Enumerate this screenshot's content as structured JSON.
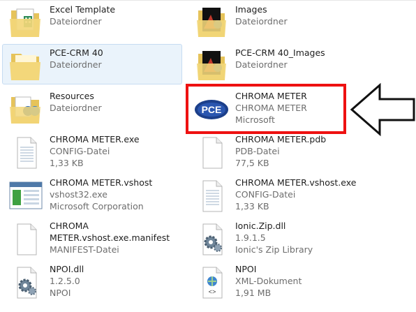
{
  "items": [
    {
      "name": "Excel Template",
      "line2": "Dateiordner",
      "line3": "",
      "icon": "folder-excel-icon"
    },
    {
      "name": "Images",
      "line2": "Dateiordner",
      "line3": "",
      "icon": "folder-images-icon"
    },
    {
      "name": "PCE-CRM 40",
      "line2": "Dateiordner",
      "line3": "",
      "icon": "folder-icon"
    },
    {
      "name": "PCE-CRM 40_Images",
      "line2": "Dateiordner",
      "line3": "",
      "icon": "folder-images-icon"
    },
    {
      "name": "Resources",
      "line2": "Dateiordner",
      "line3": "",
      "icon": "folder-resources-icon"
    },
    {
      "name": "CHROMA METER",
      "line2": "CHROMA METER",
      "line3": "Microsoft",
      "icon": "pce-app-icon"
    },
    {
      "name": "CHROMA METER.exe",
      "line2": "CONFIG-Datei",
      "line3": "1,33 KB",
      "icon": "document-icon"
    },
    {
      "name": "CHROMA METER.pdb",
      "line2": "PDB-Datei",
      "line3": "77,5 KB",
      "icon": "document-icon"
    },
    {
      "name": "CHROMA METER.vshost",
      "line2": "vshost32.exe",
      "line3": "Microsoft Corporation",
      "icon": "application-window-icon"
    },
    {
      "name": "CHROMA METER.vshost.exe",
      "line2": "CONFIG-Datei",
      "line3": "1,33 KB",
      "icon": "document-icon"
    },
    {
      "name": "CHROMA",
      "line2": "METER.vshost.exe.manifest",
      "line3": "MANIFEST-Datei",
      "icon": "document-blank-icon"
    },
    {
      "name": "Ionic.Zip.dll",
      "line2": "1.9.1.5",
      "line3": "Ionic's Zip Library",
      "icon": "dll-gears-icon"
    },
    {
      "name": "NPOI.dll",
      "line2": "1.2.5.0",
      "line3": "NPOI",
      "icon": "dll-gears-icon"
    },
    {
      "name": "NPOI",
      "line2": "XML-Dokument",
      "line3": "1,91 MB",
      "icon": "xml-document-icon"
    }
  ],
  "colors": {
    "highlight": "#ee1111",
    "selection": "#eaf3fb",
    "secondary_text": "#6d6d6d"
  }
}
